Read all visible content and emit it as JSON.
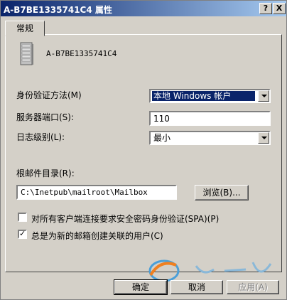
{
  "window": {
    "title": "A-B7BE1335741C4 属性",
    "help_button": "?",
    "close_button": "X"
  },
  "tabs": [
    {
      "label": "常规"
    }
  ],
  "server": {
    "name": "A-B7BE1335741C4"
  },
  "form": {
    "auth_label": "身份验证方法(M)",
    "auth_value": "本地 Windows 帐户",
    "port_label": "服务器端口(S):",
    "port_value": "110",
    "log_label": "日志级别(L):",
    "log_value": "最小",
    "root_label": "根邮件目录(R):",
    "root_value": "C:\\Inetpub\\mailroot\\Mailbox",
    "browse_label": "浏览(B)...",
    "spa_label": "对所有客户端连接要求安全密码身份验证(SPA)(P)",
    "spa_checked": false,
    "create_user_label": "总是为新的邮箱创建关联的用户(C)",
    "create_user_checked": true
  },
  "footer": {
    "ok_label": "确定",
    "cancel_label": "取消",
    "apply_label": "应用(A)"
  },
  "colors": {
    "face": "#d4d0c8",
    "title_start": "#0a246a",
    "title_end": "#a6caf0",
    "selection": "#0a246a"
  }
}
